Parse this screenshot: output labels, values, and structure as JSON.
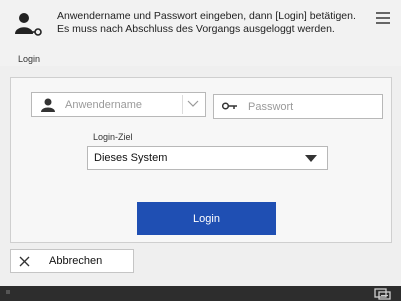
{
  "header": {
    "icon_label": "Login",
    "instruction": "Anwendername und Passwort eingeben, dann [Login] betätigen. Es muss nach Abschluss des Vorgangs ausgeloggt werden."
  },
  "form": {
    "username_placeholder": "Anwendername",
    "password_placeholder": "Passwort",
    "destination_label": "Login-Ziel",
    "destination_value": "Dieses System",
    "login_button": "Login"
  },
  "footer": {
    "cancel_label": "Abbrechen"
  },
  "colors": {
    "primary_button": "#1f4fb3",
    "status_bar": "#2d2d2d"
  }
}
